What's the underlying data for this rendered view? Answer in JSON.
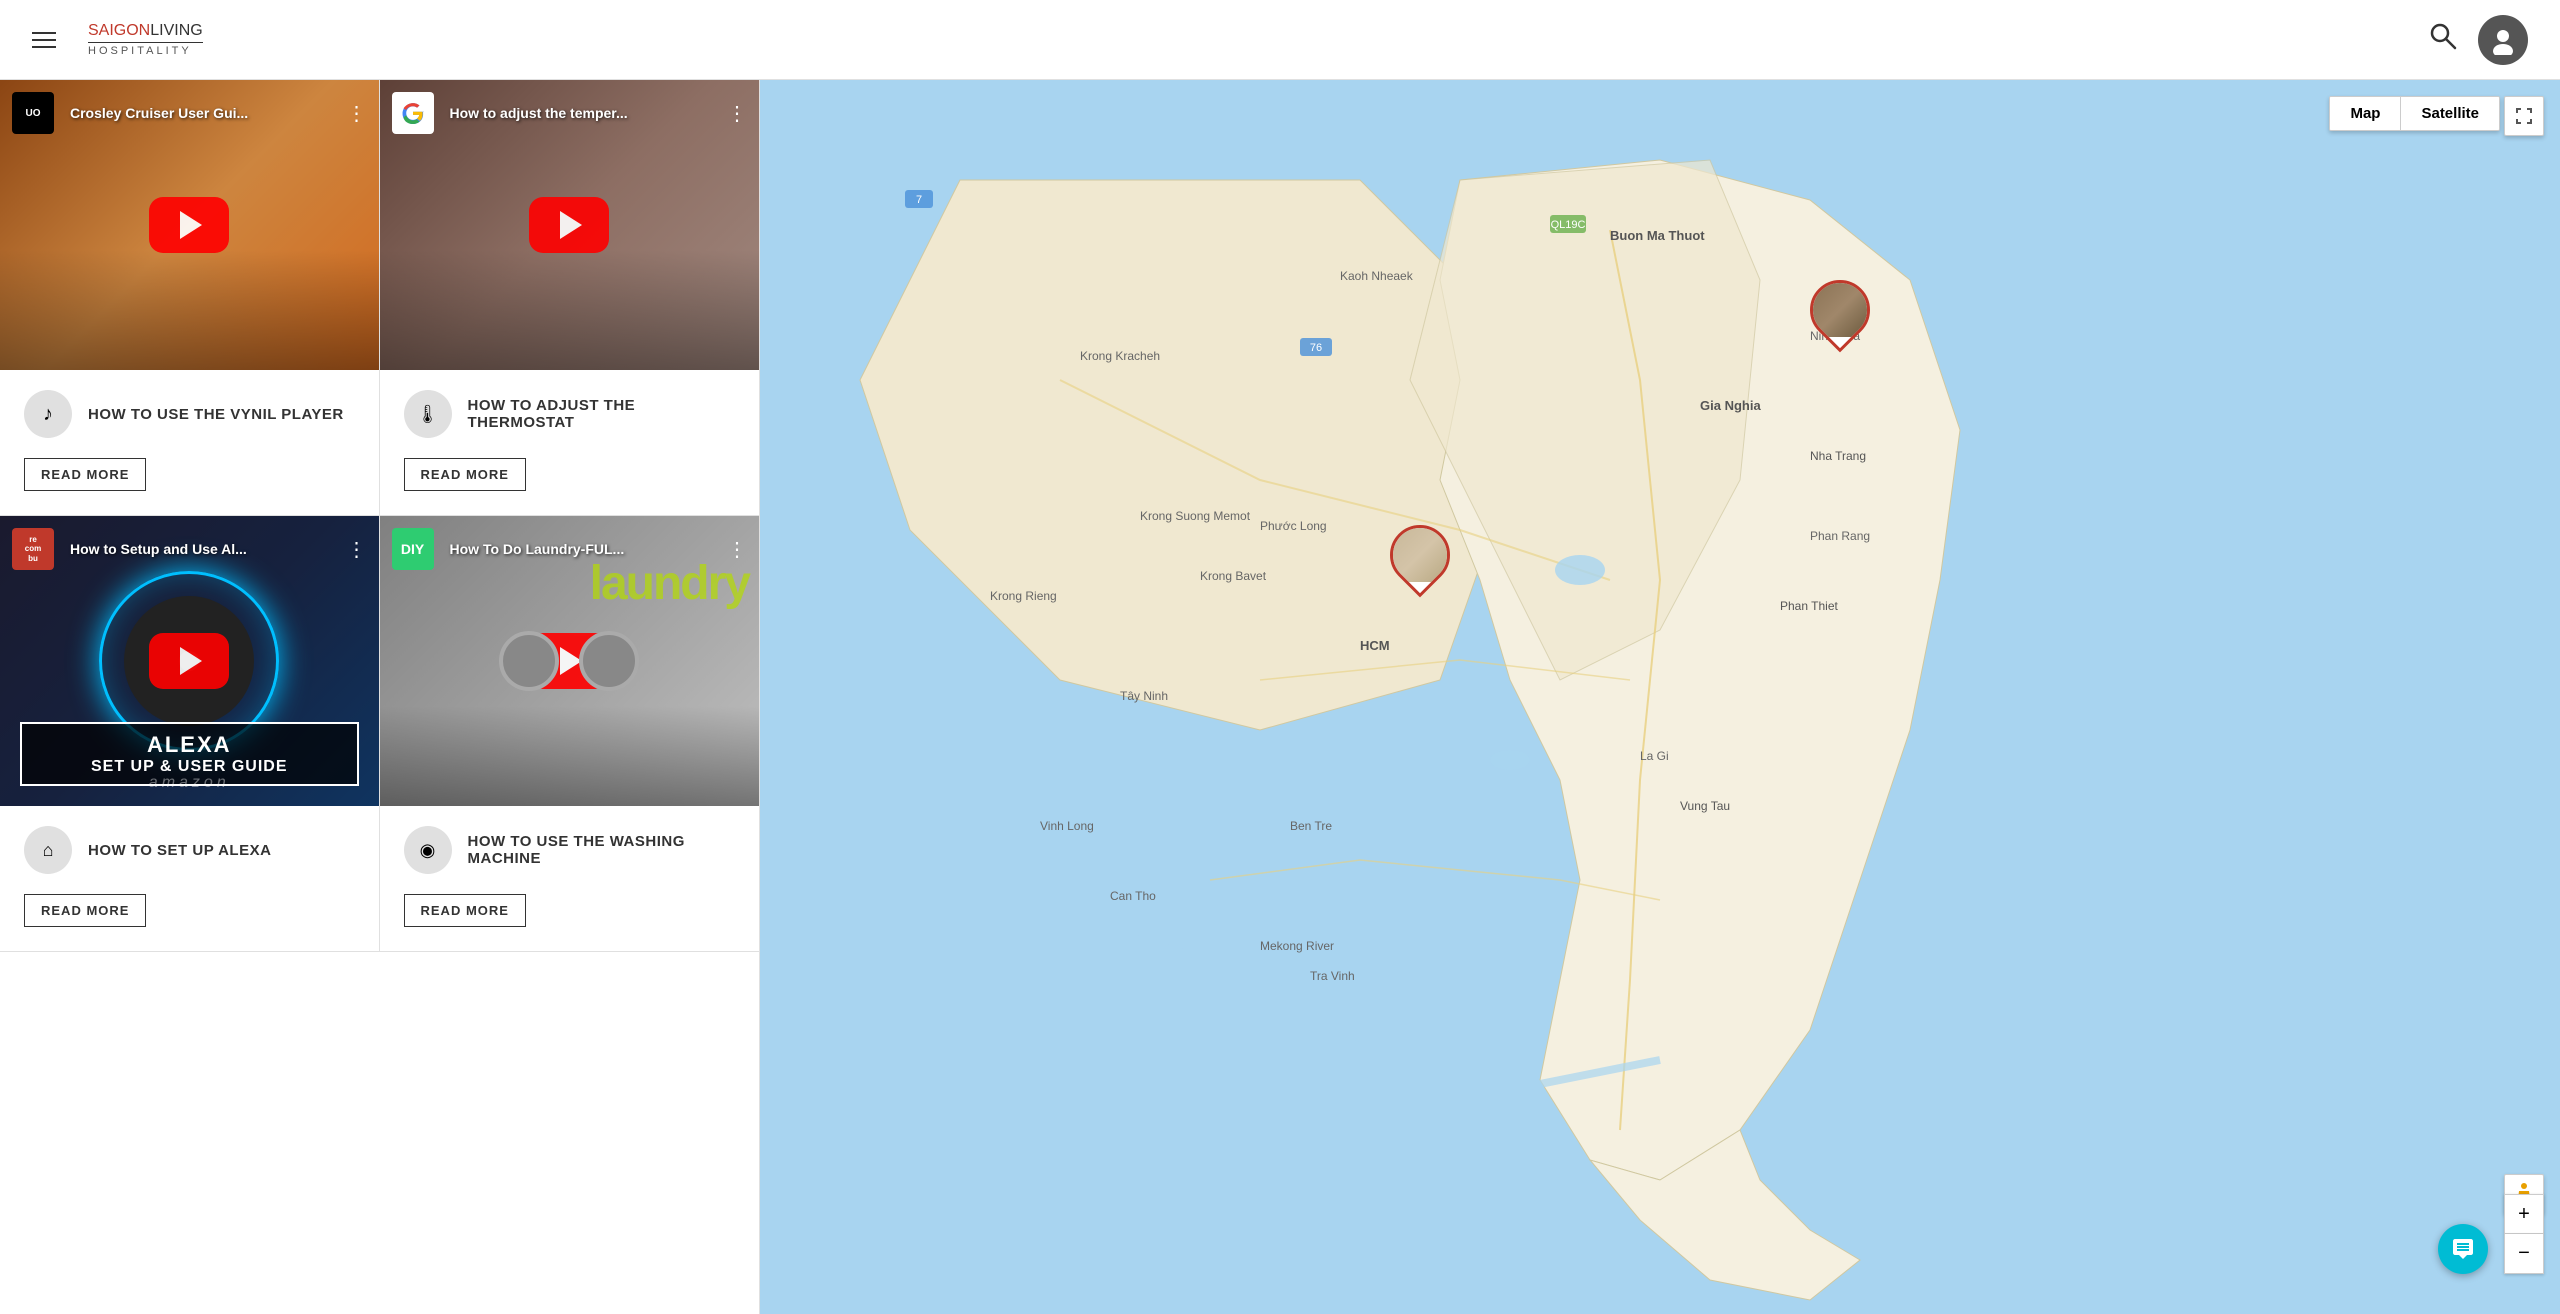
{
  "header": {
    "menu_label": "Menu",
    "logo_saigon": "SAIGON",
    "logo_living": "LIVING",
    "logo_hospitality": "HOSPITALITY",
    "search_label": "Search",
    "account_label": "Account"
  },
  "videos": [
    {
      "id": "v1",
      "title": "Crosley Cruiser User Gui...",
      "channel": "UO",
      "channel_type": "uo",
      "thumb_class": "thumb-1",
      "label": "HOW TO USE THE VYNIL PLAYER",
      "icon": "♪",
      "read_more": "READ MORE"
    },
    {
      "id": "v2",
      "title": "How to adjust the temper...",
      "channel": "G",
      "channel_type": "google",
      "thumb_class": "thumb-2",
      "label": "HOW TO ADJUST THE THERMOSTAT",
      "icon": "⊢",
      "read_more": "READ MORE"
    },
    {
      "id": "v3",
      "title": "How to Setup and Use Al...",
      "channel": "re\ncom\nbu",
      "channel_type": "recombu",
      "thumb_class": "thumb-3",
      "label": "HOW TO SET UP ALEXA",
      "icon": "⌂",
      "alexa_title": "ALEXA",
      "alexa_subtitle": "SET UP & USER GUIDE",
      "amazon_text": "amazon",
      "read_more": "READ MORE"
    },
    {
      "id": "v4",
      "title": "How To Do Laundry-FUL...",
      "channel": "DIY",
      "channel_type": "diy",
      "thumb_class": "thumb-4",
      "label": "HOW TO USE THE WASHING MACHINE",
      "icon": "◉",
      "read_more": "READ MORE"
    }
  ],
  "map": {
    "type_map": "Map",
    "type_satellite": "Satellite",
    "fullscreen_label": "Fullscreen",
    "zoom_in": "+",
    "zoom_out": "−"
  }
}
